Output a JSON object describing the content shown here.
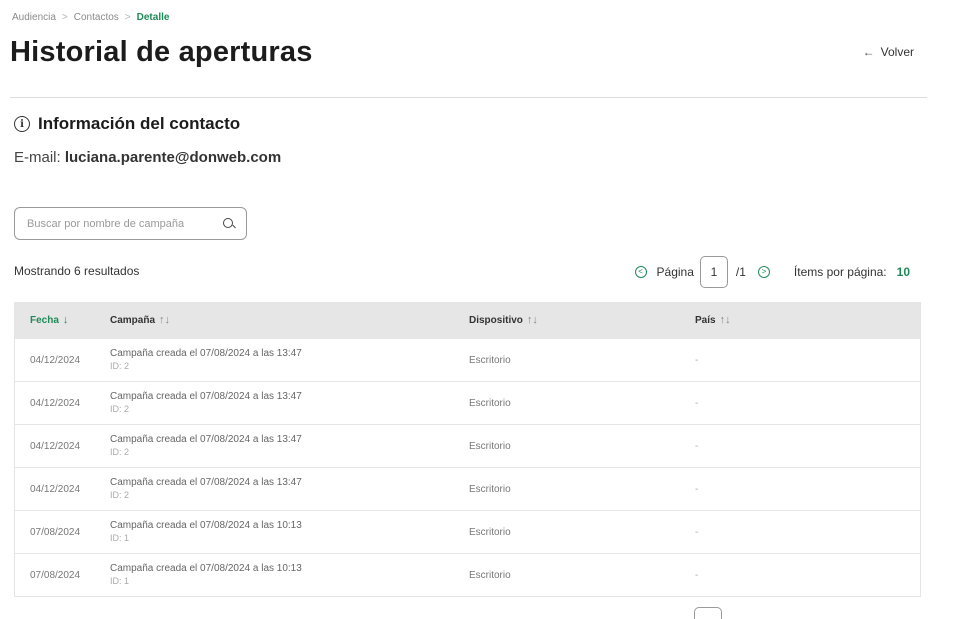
{
  "breadcrumb": {
    "items": [
      "Audiencia",
      "Contactos"
    ],
    "current": "Detalle"
  },
  "page": {
    "title": "Historial de aperturas",
    "back_label": "Volver"
  },
  "contact": {
    "section_title": "Información del contacto",
    "email_label": "E-mail:",
    "email_value": "luciana.parente@donweb.com"
  },
  "search": {
    "placeholder": "Buscar por nombre de campaña"
  },
  "results": {
    "count_text": "Mostrando 6 resultados"
  },
  "pagination": {
    "page_label": "Página",
    "current_page": "1",
    "total_text": "/1",
    "items_label": "Ítems por página:",
    "items_value": "10"
  },
  "table": {
    "headers": {
      "date": "Fecha",
      "campaign": "Campaña",
      "device": "Dispositivo",
      "country": "País"
    },
    "rows": [
      {
        "date": "04/12/2024",
        "campaign": "Campaña creada el 07/08/2024 a las 13:47",
        "id": "ID: 2",
        "device": "Escritorio",
        "country": "-"
      },
      {
        "date": "04/12/2024",
        "campaign": "Campaña creada el 07/08/2024 a las 13:47",
        "id": "ID: 2",
        "device": "Escritorio",
        "country": "-"
      },
      {
        "date": "04/12/2024",
        "campaign": "Campaña creada el 07/08/2024 a las 13:47",
        "id": "ID: 2",
        "device": "Escritorio",
        "country": "-"
      },
      {
        "date": "04/12/2024",
        "campaign": "Campaña creada el 07/08/2024 a las 13:47",
        "id": "ID: 2",
        "device": "Escritorio",
        "country": "-"
      },
      {
        "date": "07/08/2024",
        "campaign": "Campaña creada el 07/08/2024 a las 10:13",
        "id": "ID: 1",
        "device": "Escritorio",
        "country": "-"
      },
      {
        "date": "07/08/2024",
        "campaign": "Campaña creada el 07/08/2024 a las 10:13",
        "id": "ID: 1",
        "device": "Escritorio",
        "country": "-"
      }
    ]
  },
  "colors": {
    "accent": "#1f8a57",
    "header_bg": "#e6e6e6",
    "divider": "#dcdcdc"
  }
}
